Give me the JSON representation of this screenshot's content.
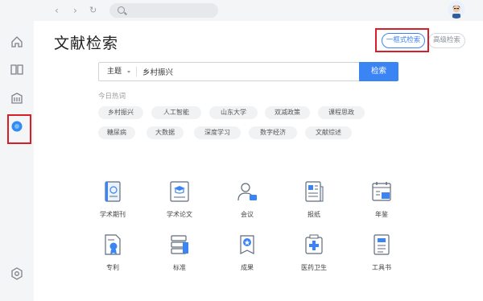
{
  "page_title": "文献检索",
  "modes": {
    "simple": "一框式检索",
    "advanced": "高级检索"
  },
  "search": {
    "field": "主题",
    "query": "乡村振兴",
    "button": "检索"
  },
  "hot": {
    "title": "今日热词",
    "row1": [
      "乡村振兴",
      "人工智能",
      "山东大学",
      "双减政策",
      "课程思政"
    ],
    "row2": [
      "糖尿病",
      "大数据",
      "深度学习",
      "数字经济",
      "文献综述"
    ]
  },
  "categories": {
    "row1": [
      "学术期刊",
      "学术论文",
      "会议",
      "报纸",
      "年鉴"
    ],
    "row2": [
      "专利",
      "标准",
      "成果",
      "医药卫生",
      "工具书"
    ]
  },
  "colors": {
    "accent": "#3b84f3",
    "highlight": "#d81e27"
  }
}
